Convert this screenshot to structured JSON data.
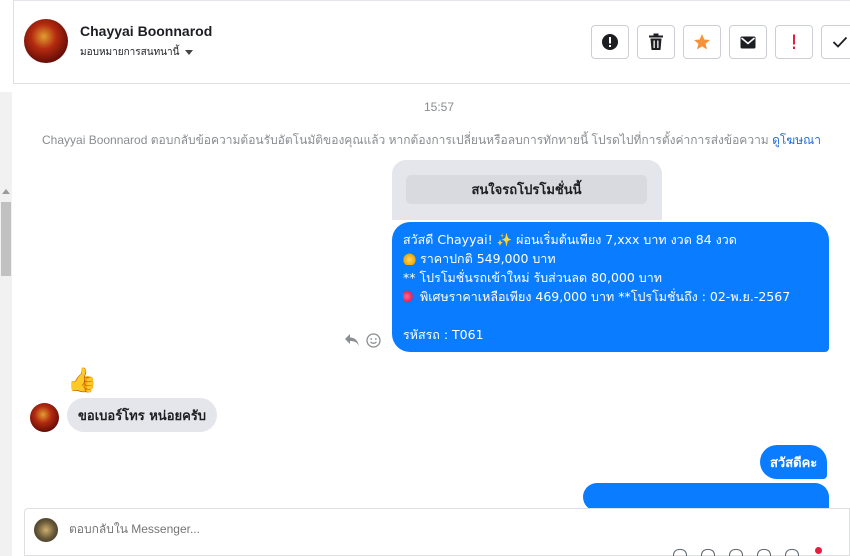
{
  "header": {
    "contact_name": "Chayyai Boonnarod",
    "assign_label": "มอบหมายการสนทนานี้"
  },
  "actions": [
    {
      "name": "report-spam",
      "icon": "exclamation-circle-icon"
    },
    {
      "name": "delete",
      "icon": "trash-icon"
    },
    {
      "name": "star",
      "icon": "star-icon",
      "color": "#f7923a"
    },
    {
      "name": "mark-unread",
      "icon": "envelope-icon"
    },
    {
      "name": "follow-up",
      "icon": "exclamation-icon",
      "color": "#e41e3f"
    },
    {
      "name": "mark-done",
      "icon": "checkmark-icon"
    }
  ],
  "conversation": {
    "timestamp": "15:57",
    "system_message": "Chayyai Boonnarod ตอบกลับข้อความต้อนรับอัตโนมัติของคุณแล้ว หากต้องการเปลี่ยนหรือลบการทักทายนี้ โปรดไปที่การตั้งค่าการส่งข้อความ",
    "system_link": "ดูโฆษณา",
    "card_button": "สนใจรถโปรโมชั่นนี้",
    "outgoing_promo": {
      "line1": "สวัสดี Chayyai! ✨  ผ่อนเริ่มต้นเพียง 7,xxx บาท งวด 84 งวด",
      "line2": "ราคาปกติ 549,000 บาท",
      "line3": "** โปรโมชั่นรถเข้าใหม่ รับส่วนลด 80,000 บาท",
      "line4": "พิเศษราคาเหลือเพียง 469,000 บาท  **โปรโมชั่นถึง : 02-พ.ย.-2567",
      "line5": "รหัสรถ : T061"
    },
    "reaction": "👍",
    "incoming_message": "ขอเบอร์โทร หน่อยครับ",
    "outgoing_hello": "สวัสดีคะ"
  },
  "composer": {
    "placeholder": "ตอบกลับใน Messenger..."
  },
  "colors": {
    "accent_blue": "#0a7cff",
    "incoming_gray": "#e4e6eb",
    "link_blue": "#216fdb"
  }
}
